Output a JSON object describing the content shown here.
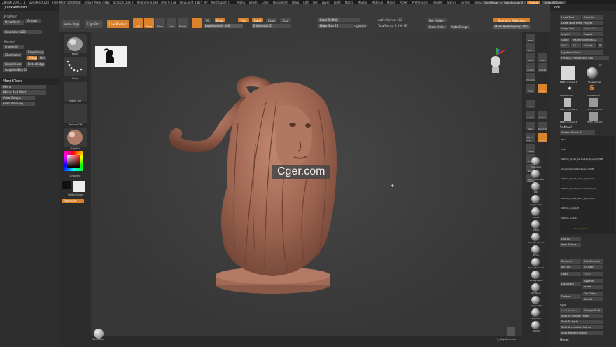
{
  "menubar": {
    "title": "ZBrush 2020.1.1",
    "stats": [
      "DynaMesh128",
      "Free Mem 54.698GB",
      "Active Mem 7,482",
      "Scratch Disk 7",
      "Realtime 0.698 Timer 0.238",
      "PolyCount 3,875 MP",
      "MeshCount 7"
    ],
    "menus": [
      "Alpha",
      "Brush",
      "Color",
      "Document",
      "Draw",
      "Edit",
      "File",
      "Layer",
      "Light",
      "Macro",
      "Marker",
      "Material",
      "Movie",
      "Picker",
      "Preferences",
      "Render",
      "Stencil",
      "Stroke",
      "Texture",
      "Tool",
      "Transform",
      "Zplugin",
      "Zscript",
      "Help"
    ],
    "right_items": [
      "QuickSave",
      "See-through 0",
      "Menus",
      "DefaultZScript"
    ]
  },
  "left_panel": {
    "title": "QuickRemesh",
    "dynamesh_title": "DynaMesh",
    "dynamesh_btn": "DynaMesh",
    "groups_btn": "Groups",
    "resolution": "Resolution 128",
    "remesh_title": "Remesh",
    "project_all": "ProjectAll",
    "zremesher": "ZRemesher",
    "keep_groups": "KeepGroups",
    "same": "Same",
    "adapt": "Adapt",
    "half": "Half",
    "keep_creases": "KeepCreases",
    "detect_edges": "DetectEdges",
    "adaptive_size": "AdaptiveSize 50",
    "morph_title": "MorphTools",
    "mirror": "Mirror",
    "mirror_weld": "Mirror And Weld",
    "auto_groups": "Auto Groups",
    "poly_masking": "Fram Masking"
  },
  "toolbar": {
    "home_page": "Home Page",
    "lightbox": "LightBox",
    "live_boolean": "Live Boolean",
    "edit": "Edit",
    "draw": "Draw",
    "move": "Move",
    "scale": "Scale",
    "rotate": "Rotate",
    "m_btn": "M",
    "mrgb": "Mrgb",
    "rgb": "Rgb",
    "zadd": "Zadd",
    "zsub": "Zsub",
    "zcut": "Zcut",
    "rgb_intensity": "Rgb Intensity 100",
    "z_intensity": "Z Intensity 51",
    "focal_shift": "Focal Shift 0",
    "draw_size": "Draw Size 20",
    "dynamic": "Dynamic",
    "active_points": "ActivePoints: 482",
    "total_points": "TotalPoints: 2.296 Mil",
    "del_hidden": "Del Hidden",
    "close_holes": "Close Holes",
    "auto_groups": "Auto Groups",
    "spotlight": "Spotlight Projection",
    "mask_polygroup": "Mask By Polygroup 100"
  },
  "shelf": {
    "items": [
      "Move",
      "Dots",
      "Alpha Off",
      "Texture Off",
      "PolyBox"
    ],
    "gradient": "Gradient",
    "switch_color": "SwitchColor",
    "alternate": "Alternate"
  },
  "canvas": {
    "watermark": "Cger.com"
  },
  "bottom": {
    "left_item": "ClayTube",
    "right_item": "S_KeyAlternate"
  },
  "right_shelf": {
    "buttons": [
      "BPR",
      "SPix 3",
      "Scroll",
      "Zoom",
      "Actual",
      "AAHalf",
      "Dynamic",
      "Persp",
      "Floor",
      "Local",
      "L.Sym",
      "Frame",
      "Move",
      "Zoom3D",
      "Rotate",
      "Line Fill PolyF",
      "Transp",
      "Ghost",
      "Solo",
      "Xpose"
    ],
    "brushes": [
      "Standard",
      "Dam_Standard",
      "Clay",
      "ClayBuildup",
      "Move",
      "Inflat",
      "Smooth Groups",
      "Pinch",
      "Dam Standard",
      "TrimDynamic",
      "SK_Slash",
      "SK_ClayFill",
      "SK_Cloth",
      "hPolish"
    ]
  },
  "right_panel": {
    "title": "Tool",
    "load_tool": "Load Tool",
    "save_as": "Save As",
    "load_tools_project": "Load Tools From Project",
    "copy_tool": "Copy Tool",
    "paste_tool": "Paste Tool",
    "import": "Import",
    "export": "Export",
    "clone": "Clone",
    "make_polymesh": "Make PolyMesh3D",
    "goz": "GoZ",
    "all": "All",
    "visible": "Visible",
    "r": "R",
    "lightbox_tools": "Lightbox▸Tools",
    "current_tool": "PM3D_Cylinder3D1 : 48",
    "tool_names": [
      "PM3D_Cylinder3",
      "SphereBrush",
      "PolyMesh3D",
      "SimpleBrush",
      "PM3D_Cylinder3",
      "PM3D_Cube3D1",
      "PM3D_Cylinder3",
      "PM3D_Cube3D1"
    ],
    "tool_count": "12",
    "subtool_title": "Subtool",
    "visible_count": "Visible Count 9",
    "subtools": [
      "Hair",
      "Eyes",
      "LWhole_dryad_decimated_keyed_COMB",
      "dryad_decimated_keyed_COMB",
      "LWhole_dryad_parts_split_comb",
      "LWhole_dryad_decimated_keyed",
      "LWhole_dryad_parts_split_comb",
      "LWhole_body4_8",
      "LWhole_body4",
      "slice helpers"
    ],
    "list_all": "List All",
    "new_folder": "New Folder",
    "rename": "Rename",
    "auto_reorder": "AutoReorder",
    "all_low": "All Low",
    "all_high": "All High",
    "copy": "Copy",
    "paste": "Paste",
    "duplicate": "Duplicate",
    "append": "Append",
    "insert": "Insert",
    "delete": "Delete",
    "del_other": "Del Other",
    "del_all": "Del All",
    "split": "Split",
    "split_hidden": "Split Hidden",
    "groups_split": "Groups Split",
    "split_similar": "Split To Similar Parts",
    "split_parts": "Split To Parts",
    "split_unmasked": "Split Unmasked Points",
    "split_masked": "Split Masked Points",
    "merge": "Merge"
  },
  "colors": {
    "accent": "#d9822b",
    "clay": "#a06a55",
    "panel": "#2e2e2e",
    "canvas": "#3a3a3a"
  }
}
